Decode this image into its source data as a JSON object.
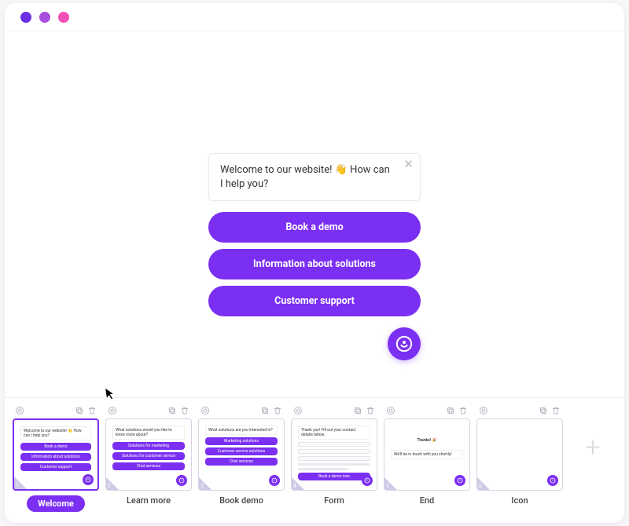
{
  "chat": {
    "greeting": "Welcome to our website! 👋 How can I help you?",
    "options": [
      "Book a demo",
      "Information about solutions",
      "Customer support"
    ]
  },
  "slides": [
    {
      "number": "1",
      "label": "Welcome",
      "active": true,
      "thumb": {
        "message": "Welcome to our website! 👋 How can I help you?",
        "buttons": [
          "Book a demo",
          "Information about solutions",
          "Customer support"
        ]
      }
    },
    {
      "number": "2",
      "label": "Learn more",
      "active": false,
      "thumb": {
        "message": "What solutions would you like to know more about?",
        "buttons": [
          "Solutions for marketing",
          "Solutions for customer service",
          "Chat services"
        ]
      }
    },
    {
      "number": "3",
      "label": "Book demo",
      "active": false,
      "thumb": {
        "message": "What solutions are you interested in?",
        "buttons": [
          "Marketing solutions",
          "Customer service solutions",
          "Chat services"
        ]
      }
    },
    {
      "number": "4",
      "label": "Form",
      "active": false,
      "thumb": {
        "type": "form",
        "message": "Thank you! Fill out your contact details below.",
        "submit": "Book a demo now"
      }
    },
    {
      "number": "5",
      "label": "End",
      "active": false,
      "thumb": {
        "type": "end",
        "thanks": "Thanks! 🎉",
        "message": "We'll be in touch with you shortly!"
      }
    },
    {
      "number": "6",
      "label": "Icon",
      "active": false,
      "thumb": {
        "type": "icon"
      }
    }
  ]
}
